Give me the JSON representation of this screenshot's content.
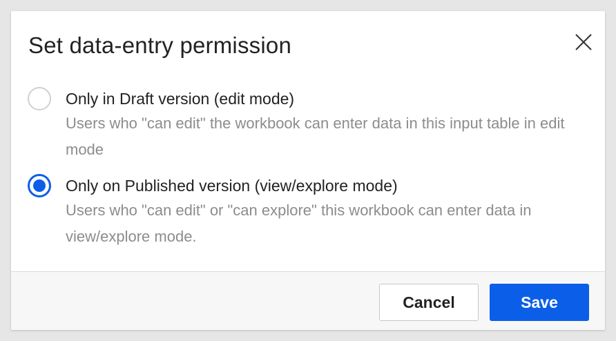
{
  "dialog": {
    "title": "Set data-entry permission",
    "close_icon": "close-icon",
    "options": [
      {
        "label": "Only in Draft version (edit mode)",
        "description": "Users who \"can edit\" the workbook can enter data in this input table in edit mode",
        "selected": false
      },
      {
        "label": "Only on Published version (view/explore mode)",
        "description": "Users who \"can edit\" or \"can explore\" this workbook can enter data in view/explore mode.",
        "selected": true
      }
    ],
    "buttons": {
      "cancel_label": "Cancel",
      "save_label": "Save"
    }
  },
  "colors": {
    "accent": "#0b5ee8",
    "text": "#222222",
    "muted_text": "#8c8c8c",
    "footer_bg": "#f7f7f7",
    "backdrop": "#e6e6e6"
  }
}
